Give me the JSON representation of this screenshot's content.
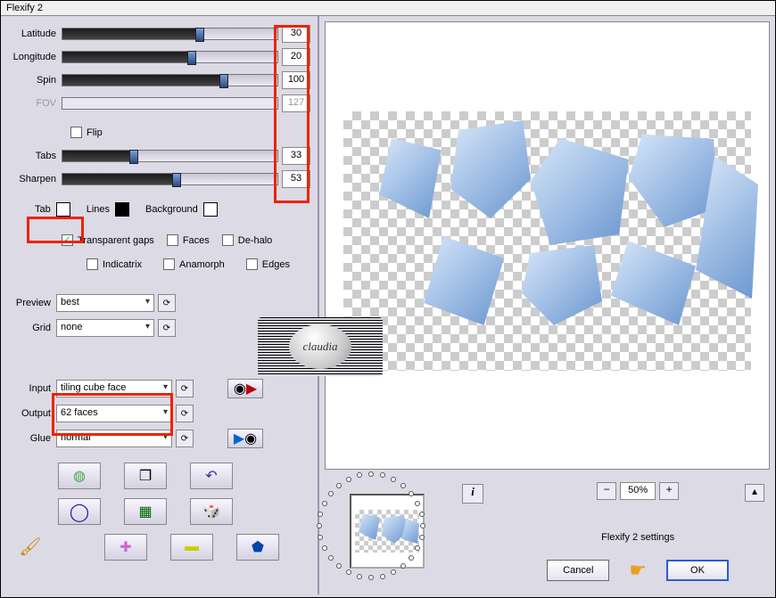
{
  "title": "Flexify 2",
  "sliders": {
    "latitude": {
      "label": "Latitude",
      "value": "30",
      "pct": 64
    },
    "longitude": {
      "label": "Longitude",
      "value": "20",
      "pct": 60
    },
    "spin": {
      "label": "Spin",
      "value": "100",
      "pct": 75
    },
    "fov": {
      "label": "FOV",
      "value": "127",
      "pct": 0
    },
    "tabs": {
      "label": "Tabs",
      "value": "33",
      "pct": 33
    },
    "sharpen": {
      "label": "Sharpen",
      "value": "53",
      "pct": 53
    }
  },
  "flip": {
    "label": "Flip",
    "checked": false
  },
  "colors": {
    "tab": {
      "label": "Tab",
      "hex": "#ffffff"
    },
    "lines": {
      "label": "Lines",
      "hex": "#000000"
    },
    "background": {
      "label": "Background",
      "hex": "#ffffff"
    }
  },
  "checks": {
    "transparent_gaps": {
      "label": "Transparent gaps",
      "checked": true
    },
    "faces": {
      "label": "Faces",
      "checked": false
    },
    "dehalo": {
      "label": "De-halo",
      "checked": false
    },
    "indicatrix": {
      "label": "Indicatrix",
      "checked": false
    },
    "anamorph": {
      "label": "Anamorph",
      "checked": false
    },
    "edges": {
      "label": "Edges",
      "checked": false
    }
  },
  "preview": {
    "label": "Preview",
    "value": "best"
  },
  "grid": {
    "label": "Grid",
    "value": "none"
  },
  "input": {
    "label": "Input",
    "value": "tiling cube face"
  },
  "output": {
    "label": "Output",
    "value": "62 faces"
  },
  "glue": {
    "label": "Glue",
    "value": "normal"
  },
  "zoom": {
    "pct": "50%"
  },
  "settings_label": "Flexify 2 settings",
  "buttons": {
    "cancel": "Cancel",
    "ok": "OK"
  },
  "watermark": "claudia"
}
